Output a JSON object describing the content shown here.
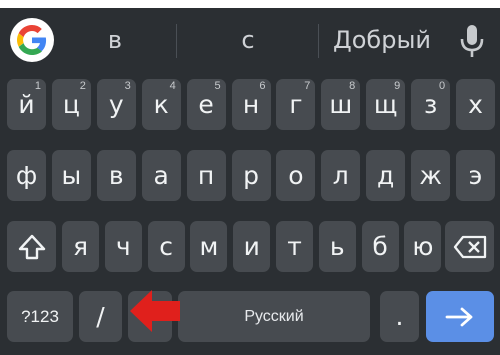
{
  "suggestions": {
    "left": "в",
    "center": "с",
    "right": "Добрый"
  },
  "icons": {
    "google": "google-g-icon",
    "mic": "microphone-icon",
    "shift": "shift-arrow-icon",
    "backspace": "backspace-icon",
    "enter": "arrow-right-icon",
    "annotation": "red-left-arrow-icon"
  },
  "colors": {
    "background": "#2b2f33",
    "key": "#474b50",
    "enter_key": "#5b8fe6",
    "annotation_arrow": "#e0201c"
  },
  "row1": [
    {
      "label": "й",
      "hint": "1"
    },
    {
      "label": "ц",
      "hint": "2"
    },
    {
      "label": "у",
      "hint": "3"
    },
    {
      "label": "к",
      "hint": "4"
    },
    {
      "label": "е",
      "hint": "5"
    },
    {
      "label": "н",
      "hint": "6"
    },
    {
      "label": "г",
      "hint": "7"
    },
    {
      "label": "ш",
      "hint": "8"
    },
    {
      "label": "щ",
      "hint": "9"
    },
    {
      "label": "з",
      "hint": "0"
    },
    {
      "label": "х",
      "hint": ""
    }
  ],
  "row2": [
    "ф",
    "ы",
    "в",
    "а",
    "п",
    "р",
    "о",
    "л",
    "д",
    "ж",
    "э"
  ],
  "row3": [
    "я",
    "ч",
    "с",
    "м",
    "и",
    "т",
    "ь",
    "б",
    "ю"
  ],
  "row4": {
    "symbols": "?123",
    "slash": "/",
    "space": "Русский",
    "period": "."
  }
}
